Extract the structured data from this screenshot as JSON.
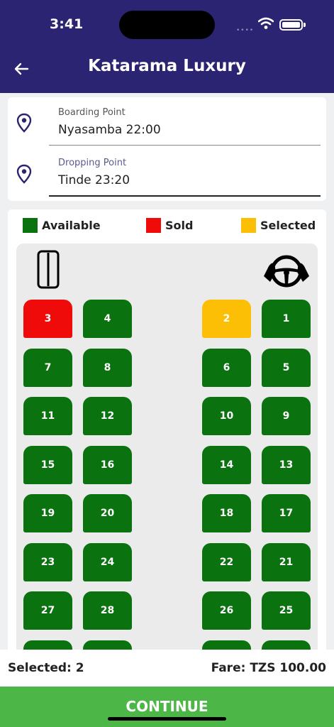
{
  "status": {
    "time": "3:41",
    "signal_dots": "••••"
  },
  "header": {
    "title": "Katarama Luxury",
    "back_icon": "arrow-left-icon"
  },
  "route": {
    "boarding_label": "Boarding Point",
    "boarding_value": "Nyasamba 22:00",
    "dropping_label": "Dropping Point",
    "dropping_value": "Tinde 23:20"
  },
  "legend": {
    "available": "Available",
    "sold": "Sold",
    "selected": "Selected"
  },
  "colors": {
    "header_bg": "#2b2472",
    "available": "#0b7210",
    "sold": "#f00b0b",
    "selected": "#fcbf06",
    "continue_bg": "#4cb646"
  },
  "seat_rows": [
    [
      {
        "n": "3",
        "s": "sold"
      },
      {
        "n": "4",
        "s": "available"
      },
      {
        "n": "2",
        "s": "selected"
      },
      {
        "n": "1",
        "s": "available"
      }
    ],
    [
      {
        "n": "7",
        "s": "available"
      },
      {
        "n": "8",
        "s": "available"
      },
      {
        "n": "6",
        "s": "available"
      },
      {
        "n": "5",
        "s": "available"
      }
    ],
    [
      {
        "n": "11",
        "s": "available"
      },
      {
        "n": "12",
        "s": "available"
      },
      {
        "n": "10",
        "s": "available"
      },
      {
        "n": "9",
        "s": "available"
      }
    ],
    [
      {
        "n": "15",
        "s": "available"
      },
      {
        "n": "16",
        "s": "available"
      },
      {
        "n": "14",
        "s": "available"
      },
      {
        "n": "13",
        "s": "available"
      }
    ],
    [
      {
        "n": "19",
        "s": "available"
      },
      {
        "n": "20",
        "s": "available"
      },
      {
        "n": "18",
        "s": "available"
      },
      {
        "n": "17",
        "s": "available"
      }
    ],
    [
      {
        "n": "23",
        "s": "available"
      },
      {
        "n": "24",
        "s": "available"
      },
      {
        "n": "22",
        "s": "available"
      },
      {
        "n": "21",
        "s": "available"
      }
    ],
    [
      {
        "n": "27",
        "s": "available"
      },
      {
        "n": "28",
        "s": "available"
      },
      {
        "n": "26",
        "s": "available"
      },
      {
        "n": "25",
        "s": "available"
      }
    ],
    [
      {
        "n": "",
        "s": "available"
      },
      {
        "n": "",
        "s": "available"
      },
      {
        "n": "",
        "s": "available"
      },
      {
        "n": "",
        "s": "available"
      }
    ]
  ],
  "footer": {
    "selected_text": "Selected: 2",
    "fare_text": "Fare: TZS 100.00",
    "continue_label": "CONTINUE"
  }
}
